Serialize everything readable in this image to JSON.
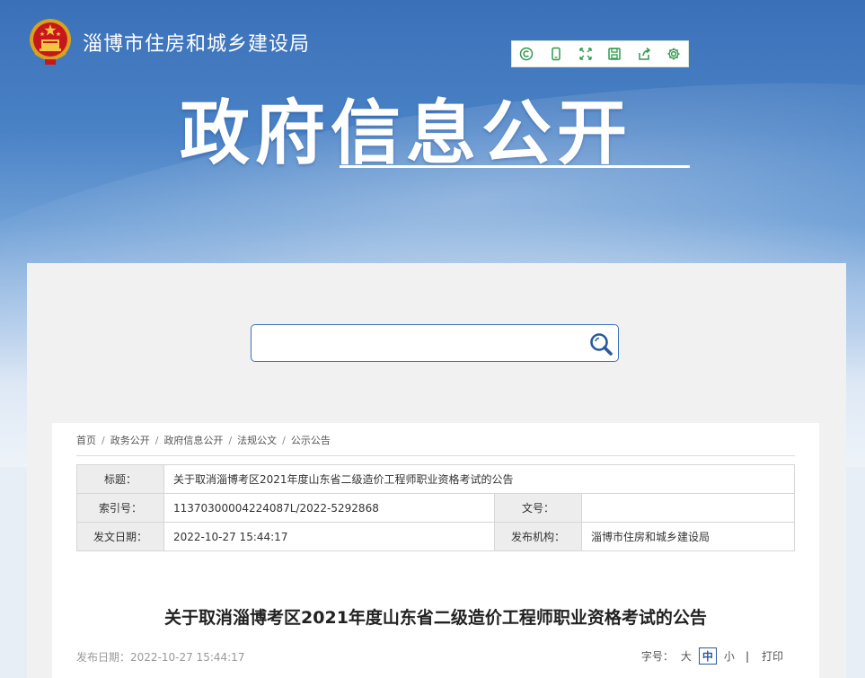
{
  "header": {
    "site_name": "淄博市住房和城乡建设局",
    "big_title": "政府信息公开",
    "toolbar_icons": [
      "copyright-icon",
      "mobile-icon",
      "expand-icon",
      "save-icon",
      "share-icon",
      "settings-icon"
    ]
  },
  "search": {
    "placeholder": "",
    "value": ""
  },
  "breadcrumb": {
    "items": [
      "首页",
      "政务公开",
      "政府信息公开",
      "法规公文",
      "公示公告"
    ],
    "separator": "/"
  },
  "meta": {
    "title_label": "标题：",
    "title_value": "关于取消淄博考区2021年度山东省二级造价工程师职业资格考试的公告",
    "index_label": "索引号：",
    "index_value": "11370300004224087L/2022-5292868",
    "docno_label": "文号：",
    "docno_value": "",
    "date_label": "发文日期：",
    "date_value": "2022-10-27 15:44:17",
    "org_label": "发布机构：",
    "org_value": "淄博市住房和城乡建设局"
  },
  "article": {
    "title": "关于取消淄博考区2021年度山东省二级造价工程师职业资格考试的公告",
    "pub_date": "发布日期：2022-10-27 15:44:17",
    "font_label": "字号：",
    "font_large": "大",
    "font_medium": "中",
    "font_small": "小",
    "print_label": "打印"
  },
  "colors": {
    "banner_blue": "#3a70b8",
    "toolbar_icon_green": "#2f9a4f",
    "search_border": "#3a73b8",
    "active_font_border": "#2a5a9a"
  }
}
